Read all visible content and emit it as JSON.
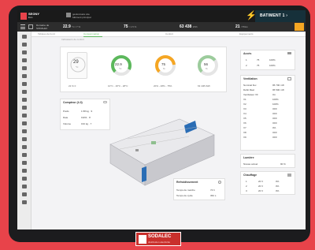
{
  "app": {
    "brand_line1": "SEGNY",
    "brand_line2": "Eco",
    "user_line1": "gestionnaire site",
    "user_line2": "bâtiment principal",
    "building": "BATIMENT 1 ›"
  },
  "stats": {
    "site_line1": "Domaine de",
    "site_line2": "SODALEC",
    "temp_value": "22.9",
    "temp_unit": "°C / 7 %",
    "humidity_value": "75",
    "humidity_unit": "/ 1.5 %",
    "energy_value": "63 438",
    "energy_unit": "kWh",
    "power_value": "21",
    "power_unit": "/ 55kw"
  },
  "tabs": [
    "Tableau de bord",
    "Consommation",
    "Confort",
    "Equipements"
  ],
  "subheader": "Indicateurs de confort",
  "gauges": [
    {
      "value": "29",
      "unit": "°C",
      "label": "22 % 0"
    },
    {
      "value": "22.9",
      "unit": "°C",
      "label": "10°C - 18°C - 28°C"
    },
    {
      "value": "75",
      "unit": "%",
      "label": "20% - 48% - 75%"
    },
    {
      "value": "56",
      "unit": "%",
      "label": "63 438 kWh"
    }
  ],
  "compteur": {
    "title": "Compteur (4.3)",
    "rows": [
      {
        "label": "Poids",
        "value": "1.58 kg · 9"
      },
      {
        "label": "Date",
        "value": "19/01 · 8"
      },
      {
        "label": "Volume",
        "value": "162 kg · 7"
      }
    ]
  },
  "panel1": {
    "title": "Accès",
    "rows": [
      {
        "a": "1",
        "b": "75",
        "c": "100%"
      },
      {
        "a": "2",
        "b": "75",
        "c": "100%"
      }
    ]
  },
  "panel2": {
    "title": "Ventilation",
    "rows": [
      {
        "label": "Nominal flux",
        "value": "95 700 m³h"
      },
      {
        "label": "Débit Réel",
        "value": "95 500 m³h"
      },
      {
        "label": "Ventilateur VF",
        "value": "On"
      },
      {
        "label": "V1",
        "value": "100%"
      },
      {
        "label": "V2",
        "value": "100%"
      },
      {
        "label": "V3",
        "value": "OFF"
      },
      {
        "label": "V4",
        "value": "OFF"
      },
      {
        "label": "V5",
        "value": "OFF"
      },
      {
        "label": "V6",
        "value": "OFF"
      },
      {
        "label": "V7",
        "value": "0%"
      },
      {
        "label": "V8",
        "value": "OFF"
      },
      {
        "label": "V9",
        "value": "OFF"
      }
    ]
  },
  "panel3": {
    "title": "Lumière",
    "label": "Niveau actuel",
    "value": "90 %"
  },
  "panel4": {
    "title": "Chauffage",
    "rows": [
      {
        "a": "1",
        "b": "20 V",
        "c": "0%"
      },
      {
        "a": "2",
        "b": "20 V",
        "c": "0%"
      },
      {
        "a": "3",
        "b": "20 V",
        "c": "0%"
      }
    ]
  },
  "panel5": {
    "title": "Refroidissement",
    "rows": [
      {
        "label": "Temps de marche",
        "value": "74 h"
      },
      {
        "label": "Temps de cycle",
        "value": "362 s"
      }
    ]
  },
  "brand_footer": {
    "name": "SODALEC",
    "tagline": "distribution électricité"
  },
  "colors": {
    "accent": "#5cb85c",
    "warning": "#f5a623",
    "brand": "#e8434a"
  }
}
